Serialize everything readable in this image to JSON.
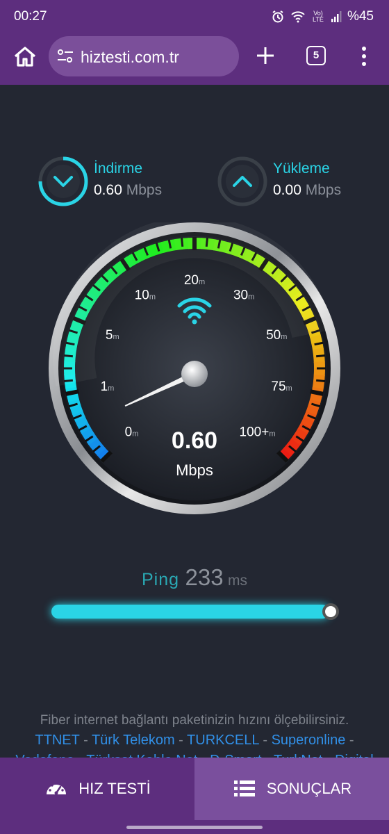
{
  "status": {
    "time": "00:27",
    "battery": "%45",
    "icons": [
      "alarm-icon",
      "wifi-icon",
      "volte-icon",
      "signal-icon"
    ],
    "volte_label": "Vo) LTE"
  },
  "browser": {
    "url": "hiztesti.com.tr",
    "tab_count": "5",
    "icons": [
      "home-icon",
      "site-settings-icon",
      "plus-icon",
      "tabs-icon",
      "overflow-menu-icon"
    ]
  },
  "download": {
    "label": "İndirme",
    "value": "0.60",
    "unit": "Mbps"
  },
  "upload": {
    "label": "Yükleme",
    "value": "0.00",
    "unit": "Mbps"
  },
  "gauge": {
    "scale_labels": [
      {
        "num": "0",
        "sub": "m"
      },
      {
        "num": "1",
        "sub": "m"
      },
      {
        "num": "5",
        "sub": "m"
      },
      {
        "num": "10",
        "sub": "m"
      },
      {
        "num": "20",
        "sub": "m"
      },
      {
        "num": "30",
        "sub": "m"
      },
      {
        "num": "50",
        "sub": "m"
      },
      {
        "num": "75",
        "sub": "m"
      },
      {
        "num": "100+",
        "sub": "m"
      }
    ],
    "value": "0.60",
    "unit": "Mbps",
    "needle_value_mbps": 0.6,
    "icon": "wifi-icon"
  },
  "ping": {
    "label": "Ping",
    "value": "233",
    "unit": "ms",
    "bar_fill_percent": 100
  },
  "footer": {
    "description": "Fiber internet bağlantı paketinizin hızını ölçebilirsiniz.",
    "providers": [
      "TTNET",
      "Türk Telekom",
      "TURKCELL",
      "Superonline"
    ],
    "separator": "-",
    "partial_line": "Vodafone - Türksat Kablo Net - D-Smart - TurkNet - Digital"
  },
  "tabs": [
    {
      "label": "HIZ TESTİ",
      "icon": "speedometer-icon",
      "active": true
    },
    {
      "label": "SONUÇLAR",
      "icon": "list-icon",
      "active": false
    }
  ],
  "colors": {
    "brand_purple": "#5d2e7e",
    "accent_cyan": "#2ad4e6",
    "link_blue": "#3190e8",
    "background": "#232732"
  }
}
